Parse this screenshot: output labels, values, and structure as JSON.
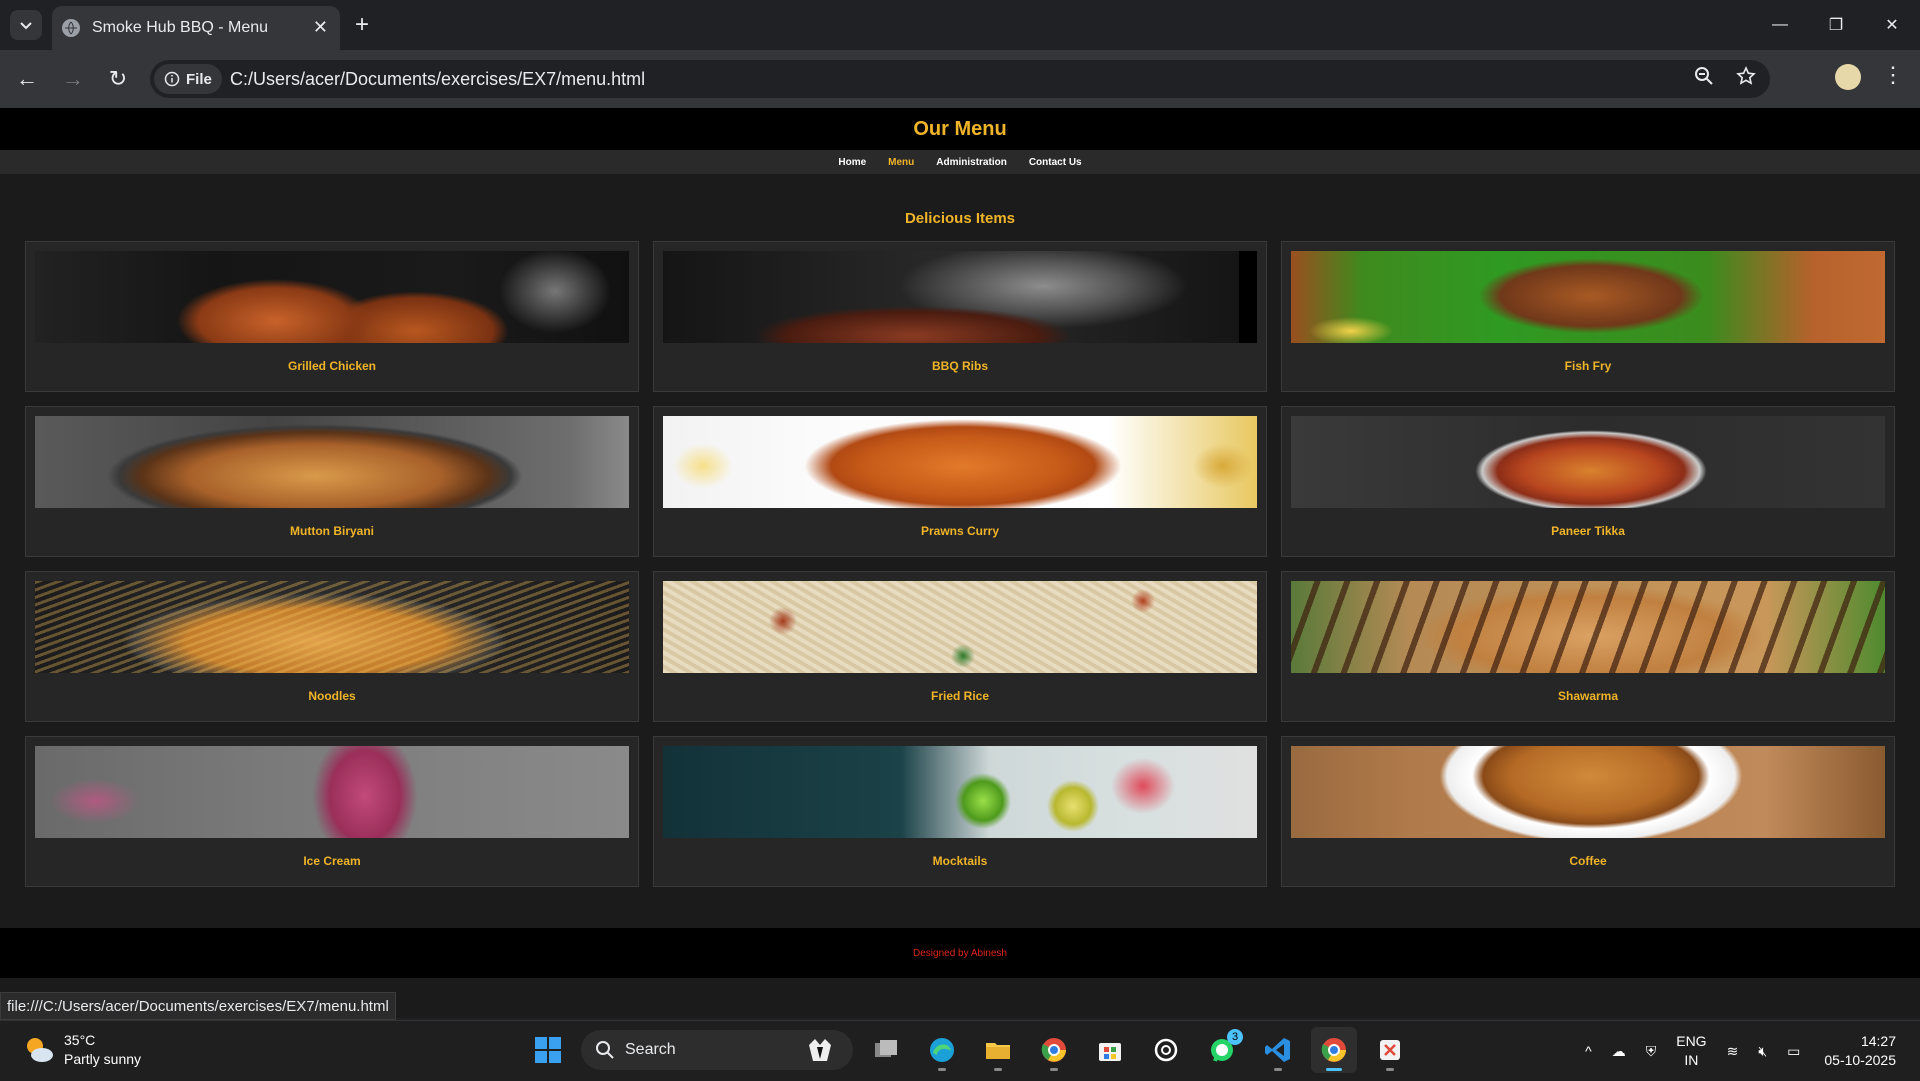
{
  "browser": {
    "tab_title": "Smoke Hub BBQ - Menu",
    "url_chip": "File",
    "url": "C:/Users/acer/Documents/exercises/EX7/menu.html",
    "status_url": "file:///C:/Users/acer/Documents/exercises/EX7/menu.html"
  },
  "site": {
    "title": "Our Menu",
    "nav": [
      {
        "label": "Home",
        "active": false
      },
      {
        "label": "Menu",
        "active": true
      },
      {
        "label": "Administration",
        "active": false
      },
      {
        "label": "Contact Us",
        "active": false
      }
    ],
    "section_title": "Delicious Items",
    "items": [
      {
        "name": "Grilled Chicken"
      },
      {
        "name": "BBQ Ribs"
      },
      {
        "name": "Fish Fry"
      },
      {
        "name": "Mutton Biryani"
      },
      {
        "name": "Prawns Curry"
      },
      {
        "name": "Paneer Tikka"
      },
      {
        "name": "Noodles"
      },
      {
        "name": "Fried Rice"
      },
      {
        "name": "Shawarma"
      },
      {
        "name": "Ice Cream"
      },
      {
        "name": "Mocktails"
      },
      {
        "name": "Coffee"
      }
    ],
    "footer": "Designed by Abinesh"
  },
  "taskbar": {
    "weather_temp": "35°C",
    "weather_desc": "Partly sunny",
    "search_label": "Search",
    "whatsapp_badge": "3",
    "lang_top": "ENG",
    "lang_bottom": "IN",
    "time": "14:27",
    "date": "05-10-2025"
  },
  "colors": {
    "accent": "#f0b429",
    "footer_text": "#e0251b",
    "header_bg": "#000000",
    "card_bg": "#262626"
  }
}
